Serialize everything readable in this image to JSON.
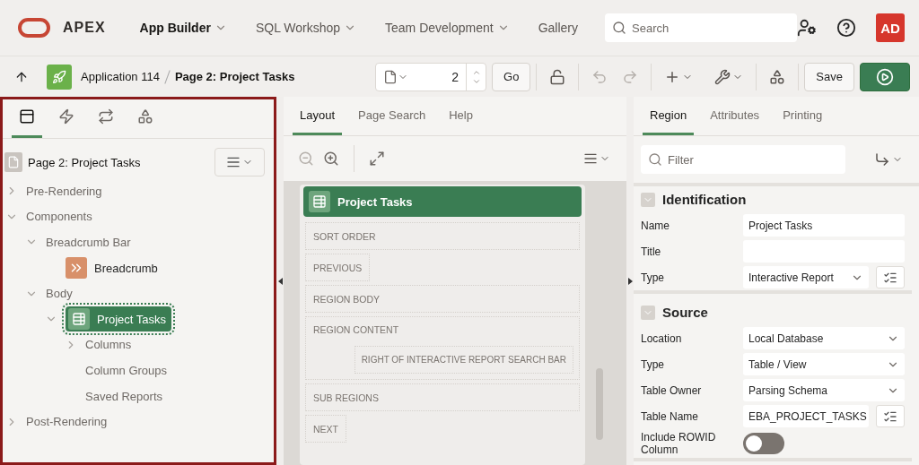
{
  "header": {
    "logo": "APEX",
    "nav": [
      {
        "label": "App Builder",
        "selected": true,
        "dropdown": true
      },
      {
        "label": "SQL Workshop",
        "selected": false,
        "dropdown": true
      },
      {
        "label": "Team Development",
        "selected": false,
        "dropdown": true
      },
      {
        "label": "Gallery",
        "selected": false,
        "dropdown": false
      }
    ],
    "search": {
      "placeholder": "Search"
    },
    "avatar": "AD"
  },
  "toolbar": {
    "application": "Application 114",
    "page": "Page 2: Project Tasks",
    "page_number": "2",
    "go": "Go",
    "save": "Save"
  },
  "tree_panel": {
    "tabs": [
      {
        "kind": "rendering",
        "selected": true
      },
      {
        "kind": "dynamic",
        "selected": false
      },
      {
        "kind": "processing",
        "selected": false
      },
      {
        "kind": "shared",
        "selected": false
      }
    ],
    "root": "Page 2: Project Tasks",
    "nodes": [
      {
        "label": "Pre-Rendering",
        "expanded": false,
        "selected": false
      },
      {
        "label": "Components",
        "expanded": true,
        "selected": false,
        "children": [
          {
            "label": "Breadcrumb Bar",
            "expanded": true,
            "selected": false,
            "children": [
              {
                "label": "Breadcrumb",
                "kind": "breadcrumb",
                "selected": false
              }
            ]
          },
          {
            "label": "Body",
            "expanded": true,
            "selected": false,
            "children": [
              {
                "label": "Project Tasks",
                "kind": "report",
                "expanded": true,
                "selected": true,
                "children": [
                  {
                    "label": "Columns",
                    "expanded": false,
                    "selected": false
                  },
                  {
                    "label": "Column Groups",
                    "selected": false
                  },
                  {
                    "label": "Saved Reports",
                    "selected": false
                  }
                ]
              }
            ]
          }
        ]
      },
      {
        "label": "Post-Rendering",
        "expanded": false,
        "selected": false
      }
    ]
  },
  "layout_panel": {
    "tabs": [
      {
        "label": "Layout",
        "selected": true
      },
      {
        "label": "Page Search",
        "selected": false
      },
      {
        "label": "Help",
        "selected": false
      }
    ],
    "region": "Project Tasks",
    "slots": [
      {
        "label": "SORT ORDER",
        "kind": "wide"
      },
      {
        "label": "PREVIOUS",
        "kind": "short"
      },
      {
        "label": "REGION BODY",
        "kind": "wide"
      },
      {
        "label": "REGION CONTENT",
        "kind": "nested",
        "inner": "RIGHT OF INTERACTIVE REPORT SEARCH BAR"
      },
      {
        "label": "SUB REGIONS",
        "kind": "wide"
      },
      {
        "label": "NEXT",
        "kind": "short"
      }
    ]
  },
  "property_panel": {
    "tabs": [
      {
        "label": "Region",
        "selected": true
      },
      {
        "label": "Attributes",
        "selected": false
      },
      {
        "label": "Printing",
        "selected": false
      }
    ],
    "filter": {
      "placeholder": "Filter"
    },
    "sections": [
      {
        "title": "Identification",
        "expanded": true,
        "fields": [
          {
            "label": "Name",
            "kind": "text",
            "value": "Project Tasks"
          },
          {
            "label": "Title",
            "kind": "text"
          },
          {
            "label": "Type",
            "kind": "select",
            "value": "Interactive Report",
            "list_button": true
          }
        ]
      },
      {
        "title": "Source",
        "expanded": true,
        "fields": [
          {
            "label": "Location",
            "kind": "select",
            "value": "Local Database"
          },
          {
            "label": "Type",
            "kind": "select",
            "value": "Table / View"
          },
          {
            "label": "Table Owner",
            "kind": "select",
            "value": "Parsing Schema"
          },
          {
            "label": "Table Name",
            "kind": "text",
            "value": "EBA_PROJECT_TASKS",
            "list_button": true
          },
          {
            "label": "Include ROWID Column",
            "kind": "toggle",
            "on": false
          }
        ]
      }
    ]
  }
}
